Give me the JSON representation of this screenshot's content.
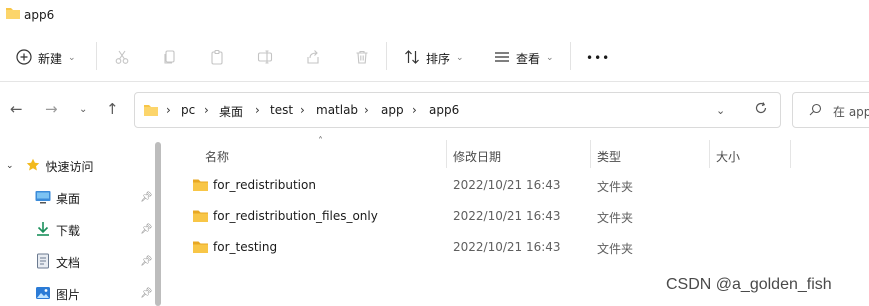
{
  "window": {
    "title": "app6"
  },
  "toolbar": {
    "new_label": "新建",
    "sort_label": "排序",
    "view_label": "查看",
    "more_label": "•••"
  },
  "address": {
    "crumbs": [
      "pc",
      "桌面",
      "test",
      "matlab",
      "app",
      "app6"
    ]
  },
  "search": {
    "placeholder": "在 app"
  },
  "sidebar": {
    "quick_access": "快速访问",
    "items": [
      {
        "label": "桌面",
        "icon": "desktop-icon"
      },
      {
        "label": "下载",
        "icon": "download-icon"
      },
      {
        "label": "文档",
        "icon": "document-icon"
      },
      {
        "label": "图片",
        "icon": "picture-icon"
      }
    ]
  },
  "columns": {
    "name": "名称",
    "modified": "修改日期",
    "type": "类型",
    "size": "大小"
  },
  "files": [
    {
      "name": "for_redistribution",
      "modified": "2022/10/21 16:43",
      "type": "文件夹"
    },
    {
      "name": "for_redistribution_files_only",
      "modified": "2022/10/21 16:43",
      "type": "文件夹"
    },
    {
      "name": "for_testing",
      "modified": "2022/10/21 16:43",
      "type": "文件夹"
    }
  ],
  "watermark": "CSDN @a_golden_fish",
  "colors": {
    "folder": "#F8C647",
    "folder_dark": "#E8A823",
    "star": "#F2B91C",
    "accent": "#0078D4"
  }
}
